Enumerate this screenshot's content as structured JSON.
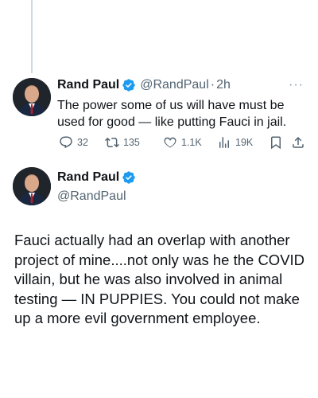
{
  "tweet1": {
    "author_name": "Rand Paul",
    "handle": "@RandPaul",
    "separator": "·",
    "time": "2h",
    "text": "The power some of us will have must be used for good — like putting Fauci in jail.",
    "stats": {
      "replies": "32",
      "retweets": "135",
      "likes": "1.1K",
      "views": "19K"
    }
  },
  "tweet2": {
    "author_name": "Rand Paul",
    "handle": "@RandPaul",
    "text": "Fauci actually had an overlap with another project of mine....not only was he the COVID villain, but he was also involved in animal testing — IN PUPPIES. You could not make up a more evil government employee."
  },
  "icons": {
    "verified": "verified-badge-icon",
    "more": "more-options-icon",
    "reply": "reply-icon",
    "retweet": "retweet-icon",
    "like": "heart-icon",
    "views": "views-icon",
    "bookmark": "bookmark-icon",
    "share": "share-icon"
  },
  "colors": {
    "verified_blue": "#1d9bf0",
    "secondary_text": "#536471",
    "primary_text": "#0f1419"
  }
}
